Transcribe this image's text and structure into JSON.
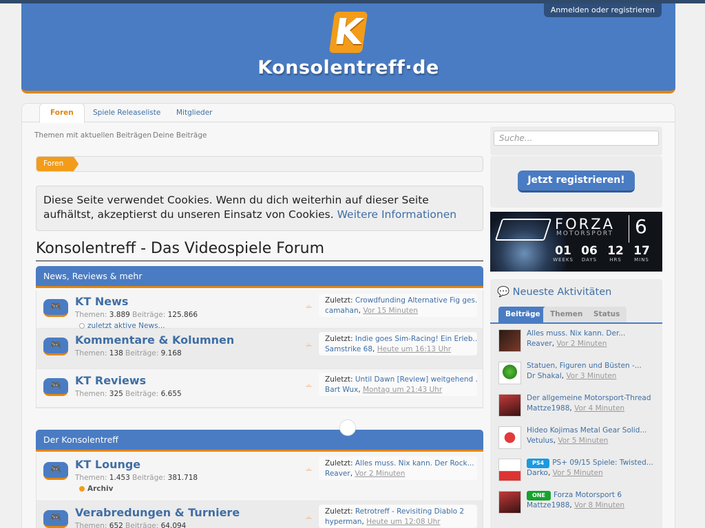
{
  "header": {
    "login_label": "Anmelden oder registrieren",
    "logo_letter": "K",
    "logo_text": "Konsolentreff·de",
    "brand_color": "#4a7cc3",
    "accent_color": "#e2860f"
  },
  "nav": {
    "tabs": [
      {
        "label": "Foren"
      },
      {
        "label": "Spiele Releaseliste"
      },
      {
        "label": "Mitglieder"
      }
    ],
    "sub": [
      {
        "label": "Themen mit aktuellen Beiträgen"
      },
      {
        "label": "Deine Beiträge"
      }
    ]
  },
  "breadcrumb": {
    "label": "Foren"
  },
  "cookie": {
    "text": "Diese Seite verwendet Cookies. Wenn du dich weiterhin auf dieser Seite aufhältst, akzeptierst du unseren Einsatz von Cookies.",
    "link": "Weitere Informationen"
  },
  "forum_title": "Konsolentreff - Das Videospiele Forum",
  "categories": [
    {
      "title": "News, Reviews & mehr",
      "nodes": [
        {
          "title": "KT News",
          "threads_label": "Themen:",
          "threads": "3.889",
          "posts_label": "Beiträge:",
          "posts": "125.866",
          "sub": "zuletzt aktive News...",
          "last_label": "Zuletzt:",
          "last_thread": "Crowdfunding Alternative Fig ges...",
          "last_user": "camahan",
          "last_time": "Vor 15 Minuten"
        },
        {
          "title": "Kommentare & Kolumnen",
          "threads_label": "Themen:",
          "threads": "138",
          "posts_label": "Beiträge:",
          "posts": "9.168",
          "sub": "",
          "last_label": "Zuletzt:",
          "last_thread": "Indie goes Sim-Racing! Ein Erleb...",
          "last_user": "Samstrike 68",
          "last_time": "Heute um 16:13 Uhr"
        },
        {
          "title": "KT Reviews",
          "threads_label": "Themen:",
          "threads": "325",
          "posts_label": "Beiträge:",
          "posts": "6.655",
          "sub": "",
          "last_label": "Zuletzt:",
          "last_thread": "Until Dawn [Review] weitgehend ...",
          "last_user": "Bart Wux",
          "last_time": "Montag um 21:43 Uhr"
        }
      ]
    },
    {
      "title": "Der Konsolentreff",
      "nodes": [
        {
          "title": "KT Lounge",
          "threads_label": "Themen:",
          "threads": "1.453",
          "posts_label": "Beiträge:",
          "posts": "381.718",
          "sub": "Archiv",
          "last_label": "Zuletzt:",
          "last_thread": "Alles muss. Nix kann. Der Rock...",
          "last_user": "Reaver",
          "last_time": "Vor 2 Minuten"
        },
        {
          "title": "Verabredungen & Turniere",
          "threads_label": "Themen:",
          "threads": "652",
          "posts_label": "Beiträge:",
          "posts": "64.094",
          "sub": "",
          "last_label": "Zuletzt:",
          "last_thread": "Retrotreff - Revisiting Diablo 2",
          "last_user": "hyperman",
          "last_time": "Heute um 12:08 Uhr"
        }
      ]
    }
  ],
  "sidebar": {
    "search_placeholder": "Suche...",
    "register_label": "Jetzt registrieren!",
    "forza": {
      "name": "FORZA",
      "sub": "MOTORSPORT",
      "number": "6",
      "countdown": [
        {
          "value": "01",
          "unit": "WEEKS"
        },
        {
          "value": "06",
          "unit": "DAYS"
        },
        {
          "value": "12",
          "unit": "HRS"
        },
        {
          "value": "17",
          "unit": "MINS"
        }
      ]
    },
    "activity": {
      "title": "Neueste Aktivitäten",
      "tabs": [
        {
          "label": "Beiträge"
        },
        {
          "label": "Themen"
        },
        {
          "label": "Status"
        }
      ],
      "items": [
        {
          "title": "Alles muss. Nix kann. Der...",
          "user": "Reaver",
          "time": "Vor 2 Minuten",
          "badge": ""
        },
        {
          "title": "Statuen, Figuren und Büsten -...",
          "user": "Dr Shakal",
          "time": "Vor 3 Minuten",
          "badge": ""
        },
        {
          "title": "Der allgemeine Motorsport-Thread",
          "user": "Mattze1988",
          "time": "Vor 4 Minuten",
          "badge": ""
        },
        {
          "title": "Hideo Kojimas Metal Gear Solid...",
          "user": "Vetulus",
          "time": "Vor 5 Minuten",
          "badge": ""
        },
        {
          "title": "PS+ 09/15 Spiele: Twisted...",
          "user": "Darko",
          "time": "Vor 5 Minuten",
          "badge": "PS4"
        },
        {
          "title": "Forza Motorsport 6",
          "user": "Mattze1988",
          "time": "Vor 8 Minuten",
          "badge": "ONE"
        }
      ]
    }
  }
}
